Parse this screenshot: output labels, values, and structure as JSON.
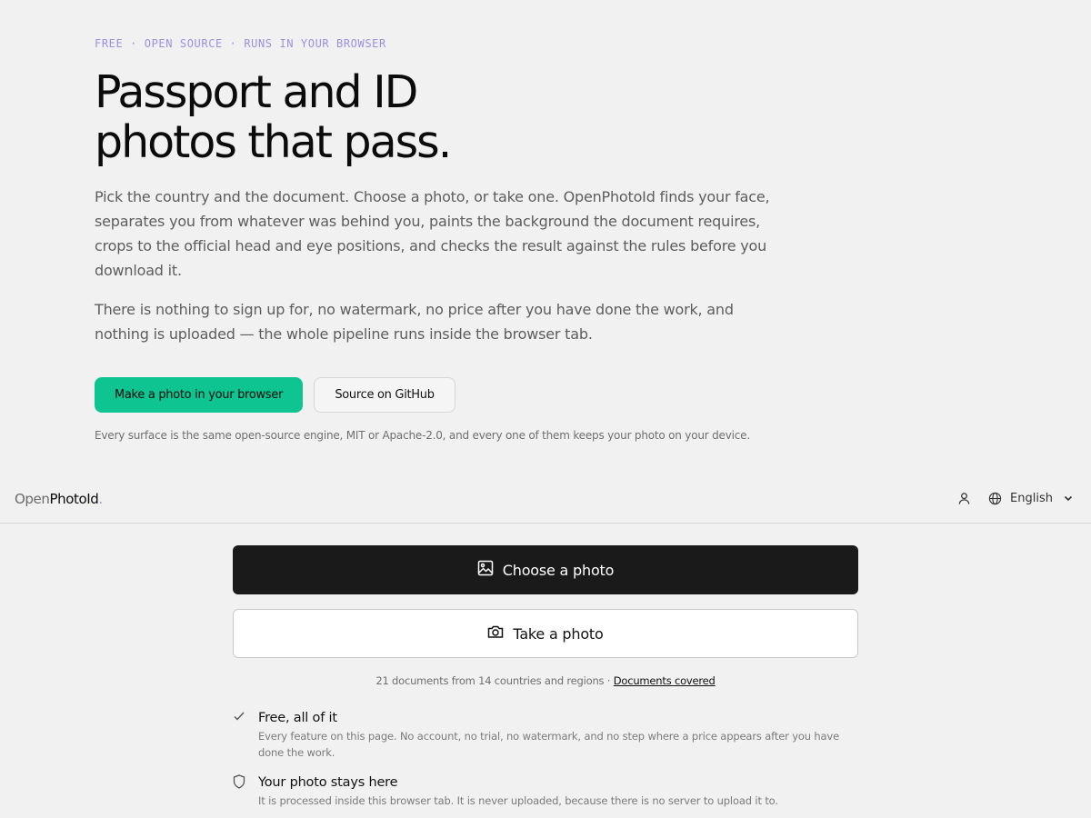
{
  "hero": {
    "eyebrow": "FREE · OPEN SOURCE · RUNS IN YOUR BROWSER",
    "headline_line1": "Passport and ID",
    "headline_line2": "photos that pass.",
    "paragraph1": "Pick the country and the document. Choose a photo, or take one. OpenPhotoId finds your face, separates you from whatever was behind you, paints the background the document requires, crops to the official head and eye positions, and checks the result against the rules before you download it.",
    "paragraph2": "There is nothing to sign up for, no watermark, no price after you have done the work, and nothing is uploaded — the whole pipeline runs inside the browser tab.",
    "primary_cta": "Make a photo in your browser",
    "secondary_cta": "Source on GitHub",
    "fineprint": "Every surface is the same open-source engine, MIT or Apache-2.0, and every one of them keeps your photo on your device."
  },
  "app": {
    "brand_part1": "Open",
    "brand_part2": "PhotoId",
    "brand_part3": ".",
    "account_icon": "user-icon",
    "language_icon": "globe-icon",
    "language": "English",
    "choose_photo": "Choose a photo",
    "take_photo": "Take a photo",
    "coverage_text": "21 documents from 14 countries and regions · ",
    "coverage_link": "Documents covered",
    "features": [
      {
        "icon": "check-icon",
        "title": "Free, all of it",
        "description": "Every feature on this page. No account, no trial, no watermark, and no step where a price appears after you have done the work."
      },
      {
        "icon": "shield-icon",
        "title": "Your photo stays here",
        "description": "It is processed inside this browser tab. It is never uploaded, because there is no server to upload it to."
      }
    ]
  },
  "colors": {
    "accent_green": "#0ec591",
    "eyebrow_purple": "#9b90e0",
    "dark_button": "#1a1a1a",
    "background": "#f1f1f1"
  }
}
